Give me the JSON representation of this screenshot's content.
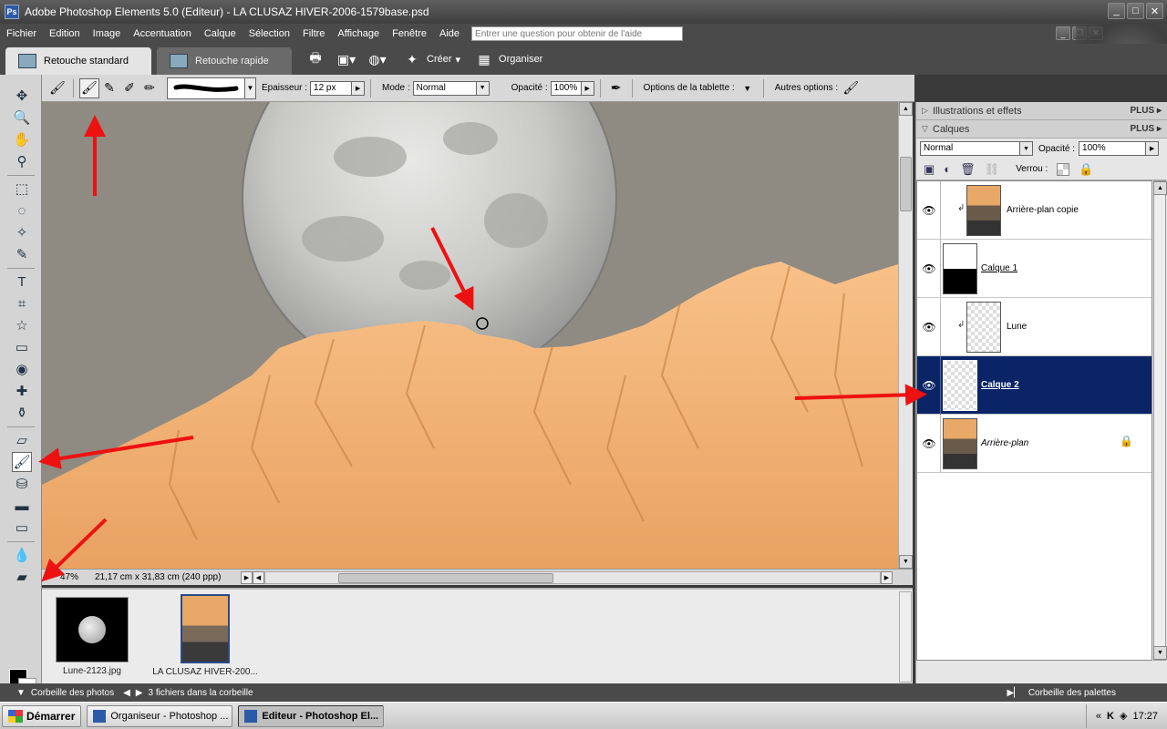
{
  "window": {
    "title": "Adobe Photoshop Elements 5.0 (Editeur) - LA CLUSAZ HIVER-2006-1579base.psd",
    "app_icon": "Ps",
    "minimize": "_",
    "maximize": "□",
    "close": "✕"
  },
  "menu": {
    "items": [
      "Fichier",
      "Edition",
      "Image",
      "Accentuation",
      "Calque",
      "Sélection",
      "Filtre",
      "Affichage",
      "Fenêtre",
      "Aide"
    ],
    "help_placeholder": "Entrer une question pour obtenir de l'aide"
  },
  "shortcuts": {
    "tab_standard": "Retouche standard",
    "tab_rapide": "Retouche rapide",
    "creer": "Créer",
    "organiser": "Organiser"
  },
  "options": {
    "epaisseur_label": "Epaisseur :",
    "epaisseur_value": "12 px",
    "mode_label": "Mode :",
    "mode_value": "Normal",
    "opacite_label": "Opacité :",
    "opacite_value": "100%",
    "tablette_label": "Options de la tablette :",
    "autres_label": "Autres options :"
  },
  "status": {
    "zoom": "47%",
    "dimensions": "21,17 cm x 31,83 cm (240 ppp)"
  },
  "photo_bin": {
    "items": [
      {
        "label": "Lune-2123.jpg"
      },
      {
        "label": "LA CLUSAZ HIVER-200..."
      }
    ],
    "bar_label": "Corbeille des photos",
    "count_label": "3 fichiers dans la corbeille",
    "palettes_label": "Corbeille des palettes"
  },
  "panels": {
    "illustrations_title": "Illustrations et effets",
    "calques_title": "Calques",
    "plus_label": "PLUS",
    "blend_mode": "Normal",
    "opacity_label": "Opacité :",
    "opacity_value": "100%",
    "lock_label": "Verrou :"
  },
  "layers": [
    {
      "name": "Arrière-plan copie",
      "style": "normal",
      "linked": true
    },
    {
      "name": "Calque 1",
      "style": "underline",
      "linked": false
    },
    {
      "name": "Lune",
      "style": "normal",
      "linked": true
    },
    {
      "name": "Calque 2",
      "style": "underline-bold",
      "selected": true,
      "linked": false
    },
    {
      "name": "Arrière-plan",
      "style": "italic",
      "locked": true,
      "linked": false
    }
  ],
  "taskbar": {
    "start": "Démarrer",
    "tasks": [
      "Organiseur - Photoshop ...",
      "Editeur - Photoshop El..."
    ],
    "tray_chevrons": "«",
    "clock": "17:27"
  },
  "colors": {
    "selected_layer": "#0a2466",
    "annotation_arrow": "#ee1111",
    "mountain": "#f6b878",
    "sky": "#8f8a82",
    "foreground": "#000000",
    "background": "#ffffff"
  }
}
